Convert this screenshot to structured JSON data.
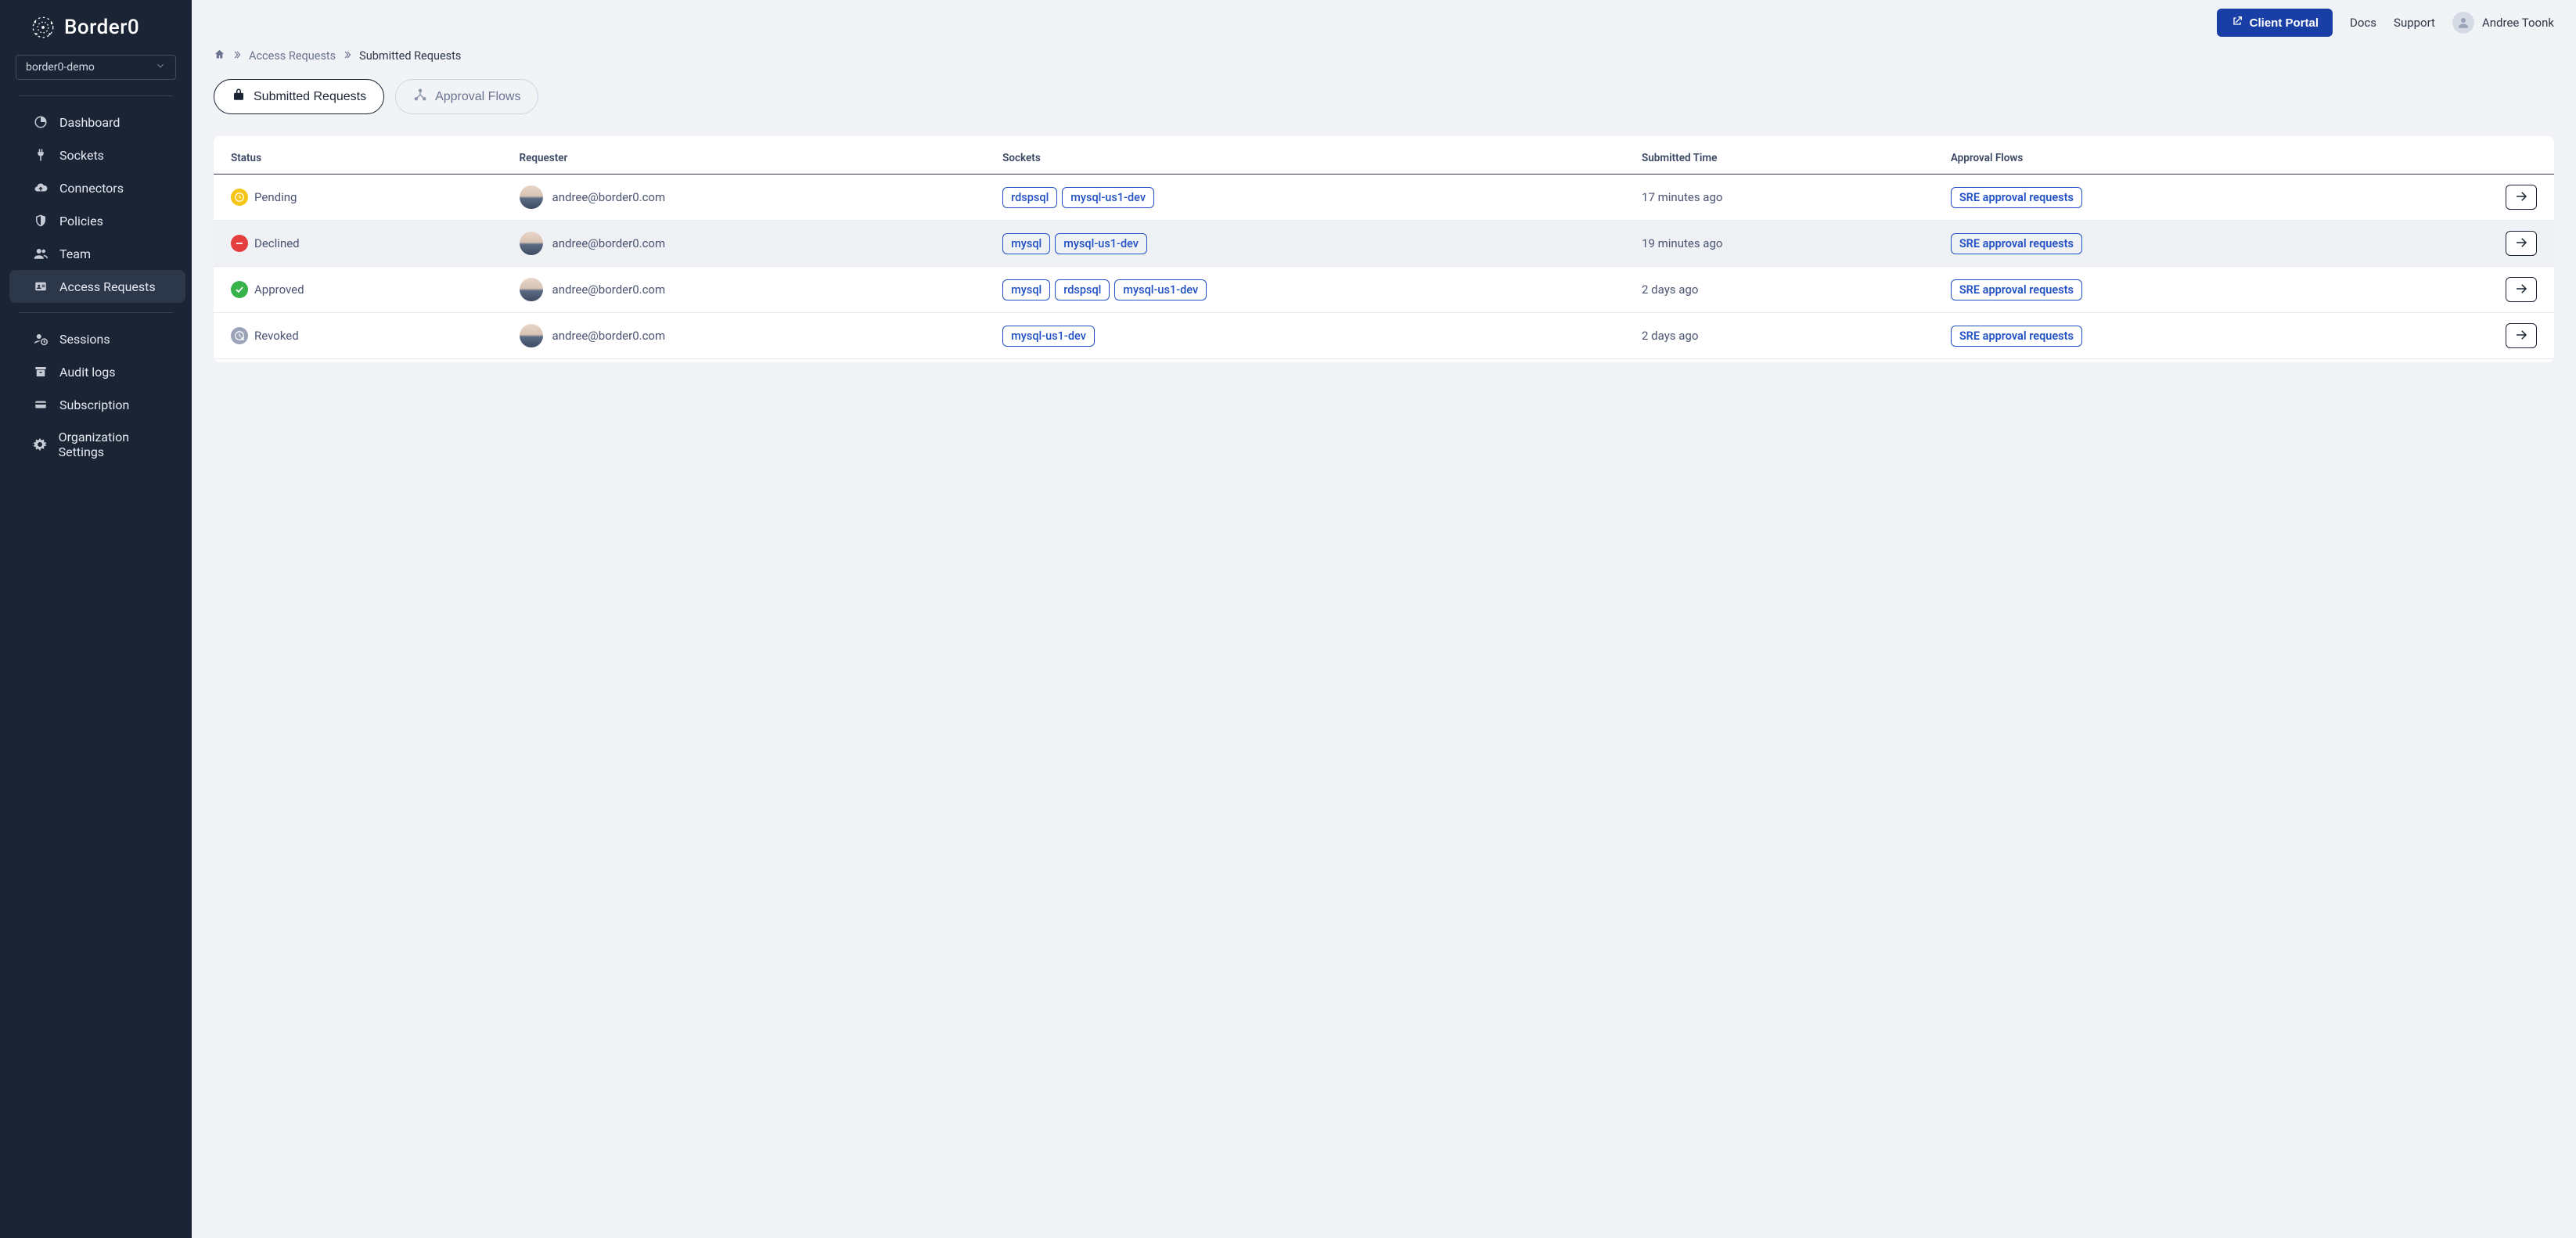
{
  "brand": {
    "name": "Border0"
  },
  "org_selector": {
    "value": "border0-demo"
  },
  "sidebar": {
    "items": [
      {
        "label": "Dashboard",
        "icon": "pie"
      },
      {
        "label": "Sockets",
        "icon": "plug"
      },
      {
        "label": "Connectors",
        "icon": "cloud-up"
      },
      {
        "label": "Policies",
        "icon": "shield"
      },
      {
        "label": "Team",
        "icon": "users"
      },
      {
        "label": "Access Requests",
        "icon": "id",
        "active": true
      }
    ],
    "items2": [
      {
        "label": "Sessions",
        "icon": "user-clock"
      },
      {
        "label": "Audit logs",
        "icon": "archive"
      },
      {
        "label": "Subscription",
        "icon": "card"
      },
      {
        "label": "Organization Settings",
        "icon": "gear"
      }
    ]
  },
  "topbar": {
    "client_portal": "Client Portal",
    "docs": "Docs",
    "support": "Support",
    "user_name": "Andree Toonk"
  },
  "breadcrumb": {
    "link": "Access Requests",
    "current": "Submitted Requests"
  },
  "tabs": {
    "submitted": "Submitted Requests",
    "approval_flows": "Approval Flows"
  },
  "table": {
    "headers": {
      "status": "Status",
      "requester": "Requester",
      "sockets": "Sockets",
      "submitted_time": "Submitted Time",
      "approval_flows": "Approval Flows"
    },
    "rows": [
      {
        "status": "Pending",
        "status_kind": "pending",
        "requester": "andree@border0.com",
        "sockets": [
          "rdspsql",
          "mysql-us1-dev"
        ],
        "submitted_time": "17 minutes ago",
        "approval_flow": "SRE approval requests"
      },
      {
        "status": "Declined",
        "status_kind": "declined",
        "requester": "andree@border0.com",
        "sockets": [
          "mysql",
          "mysql-us1-dev"
        ],
        "submitted_time": "19 minutes ago",
        "approval_flow": "SRE approval requests",
        "alt": true
      },
      {
        "status": "Approved",
        "status_kind": "approved",
        "requester": "andree@border0.com",
        "sockets": [
          "mysql",
          "rdspsql",
          "mysql-us1-dev"
        ],
        "submitted_time": "2 days ago",
        "approval_flow": "SRE approval requests"
      },
      {
        "status": "Revoked",
        "status_kind": "revoked",
        "requester": "andree@border0.com",
        "sockets": [
          "mysql-us1-dev"
        ],
        "submitted_time": "2 days ago",
        "approval_flow": "SRE approval requests"
      }
    ]
  }
}
